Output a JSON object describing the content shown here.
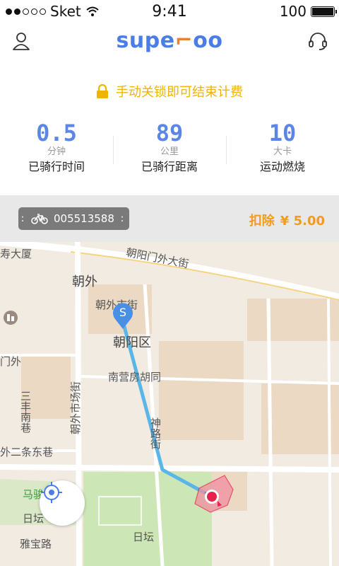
{
  "status_bar": {
    "carrier": "Sket",
    "time": "9:41",
    "battery": "100"
  },
  "header": {
    "logo_main": "supe",
    "logo_accent": "oo",
    "logo_mark": "⌐"
  },
  "trip": {
    "notice": "手动关锁即可结束计费",
    "stats": [
      {
        "value": "0.5",
        "unit": "分钟",
        "label": "已骑行时间"
      },
      {
        "value": "89",
        "unit": "公里",
        "label": "已骑行距离"
      },
      {
        "value": "10",
        "unit": "大卡",
        "label": "运动燃烧"
      }
    ]
  },
  "bike": {
    "id": "005513588"
  },
  "fee": {
    "label": "扣除",
    "amount": "¥ 5.00"
  },
  "map": {
    "start_marker": "S",
    "labels": {
      "road1": "朝阳门外大街",
      "area1": "朝外",
      "road2": "朝外市街",
      "district": "朝阳区",
      "hutong": "南营房胡同",
      "street1": "朝外市场街",
      "street2": "神路街",
      "street3": "三丰南巷",
      "street4": "外二条东巷",
      "building": "寿大厦",
      "gate": "门外",
      "place1": "马骏",
      "park": "日坛",
      "park2": "日坛",
      "road3": "雅宝路"
    }
  },
  "icons": {
    "user": "user-icon",
    "support": "headset-icon",
    "lock": "lock-icon",
    "bike": "bicycle-icon",
    "locate": "locate-icon"
  },
  "colors": {
    "accent_blue": "#5b86e5",
    "notice_yellow": "#f0b400",
    "fee_orange": "#f39c1b",
    "route": "#5bb6e8",
    "end_marker": "#e8204a"
  }
}
